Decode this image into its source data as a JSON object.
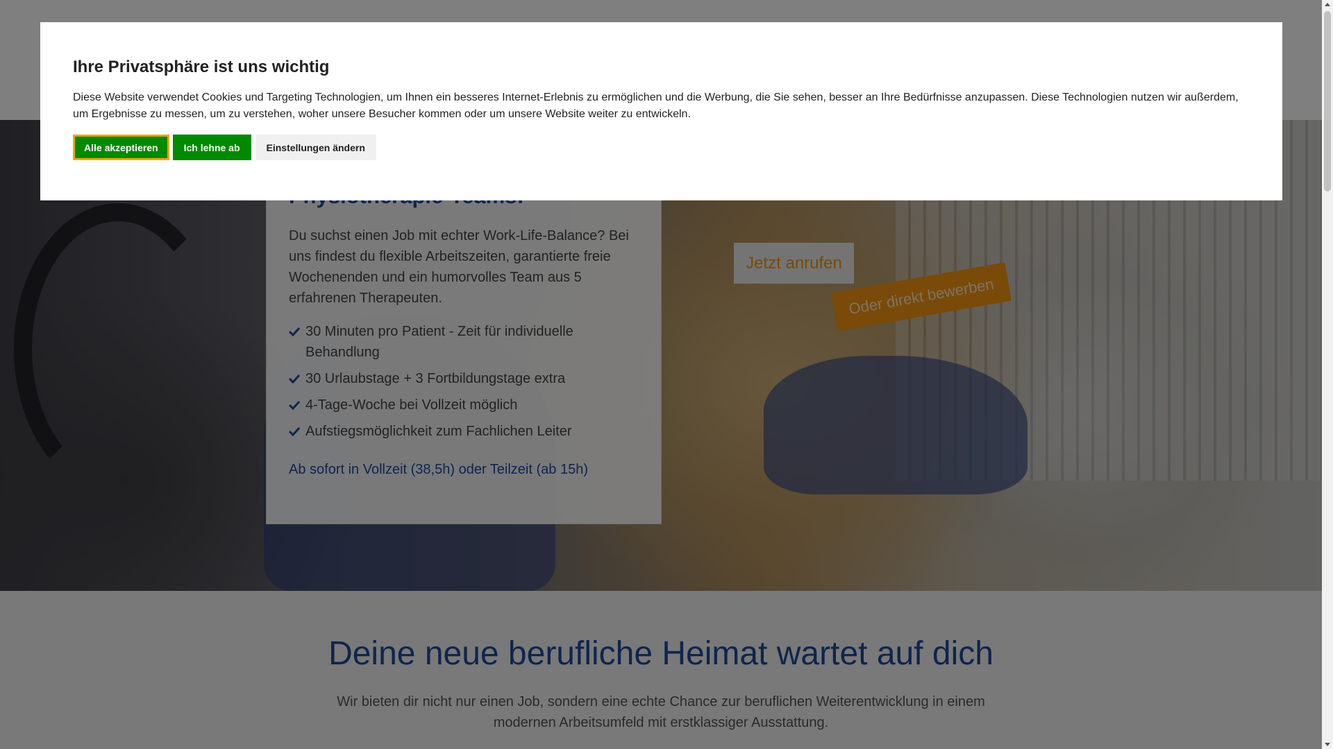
{
  "cookie_banner": {
    "title": "Ihre Privatsphäre ist uns wichtig",
    "text": "Diese Website verwendet Cookies und Targeting Technologien, um Ihnen ein besseres Internet-Erlebnis zu ermöglichen und die Werbung, die Sie sehen, besser an Ihre Bedürfnisse anzupassen. Diese Technologien nutzen wir außerdem, um Ergebnisse zu messen, um zu verstehen, woher unsere Besucher kommen oder um unsere Website weiter zu entwickeln.",
    "buttons": {
      "accept_all": "Alle akzeptieren",
      "decline": "Ich lehne ab",
      "settings": "Einstellungen ändern"
    }
  },
  "hero": {
    "card_title": "Physiotherapie-Teams!",
    "intro": "Du suchst einen Job mit echter Work-Life-Balance? Bei uns findest du flexible Arbeitszeiten, garantierte freie Wochenenden und ein humorvolles Team aus 5 erfahrenen Therapeuten.",
    "benefits": [
      "30 Minuten pro Patient - Zeit für individuelle Behandlung",
      "30 Urlaubstage + 3 Fortbildungstage extra",
      "4-Tage-Woche bei Vollzeit möglich",
      "Aufstiegsmöglichkeit zum Fachlichen Leiter"
    ],
    "hours": "Ab sofort in Vollzeit (38,5h) oder Teilzeit (ab 15h)",
    "call_button": "Jetzt anrufen",
    "apply_badge": "Oder direkt bewerben"
  },
  "section": {
    "title": "Deine neue berufliche Heimat wartet auf dich",
    "text": "Wir bieten dir nicht nur einen Job, sondern eine echte Chance zur beruflichen Weiterentwicklung in einem modernen Arbeitsumfeld mit erstklassiger Ausstattung."
  },
  "colors": {
    "brand_blue": "#1d4a9c",
    "accent_orange": "#f29410",
    "accept_green": "#008a00",
    "focus_outline": "#f2a600"
  },
  "icons": {
    "benefit_bullet": "check-icon"
  }
}
